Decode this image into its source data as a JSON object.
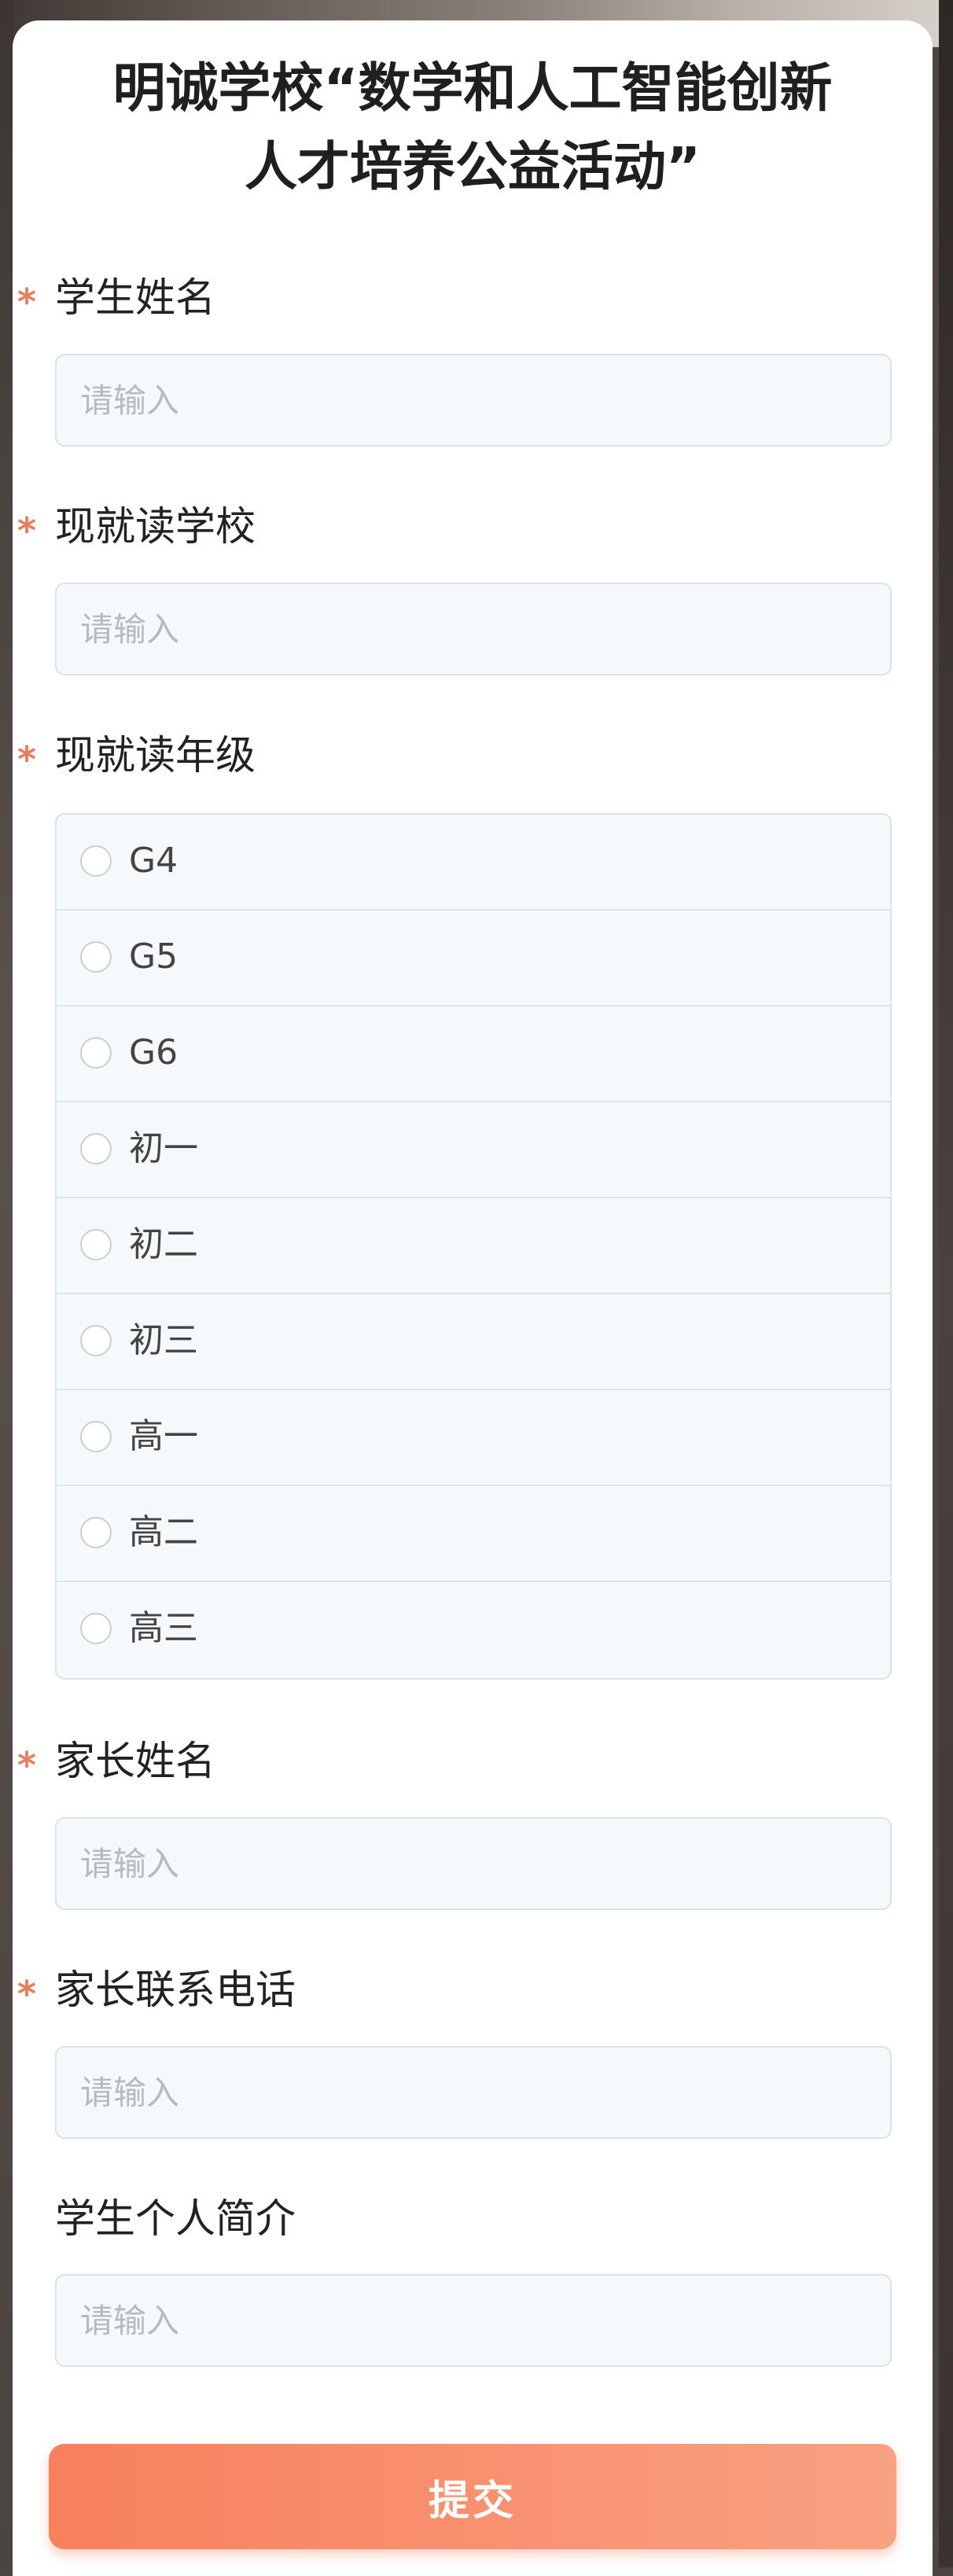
{
  "form": {
    "title_line1": "明诚学校“数学和人工智能创新",
    "title_line2": "人才培养公益活动”",
    "required_mark": "*",
    "fields": [
      {
        "label": "学生姓名",
        "placeholder": "请输入",
        "value": "",
        "required": true
      },
      {
        "label": "现就读学校",
        "placeholder": "请输入",
        "value": "",
        "required": true
      },
      {
        "label": "家长姓名",
        "placeholder": "请输入",
        "value": "",
        "required": true
      },
      {
        "label": "家长联系电话",
        "placeholder": "请输入",
        "value": "",
        "required": true
      },
      {
        "label": "学生个人简介",
        "placeholder": "请输入",
        "value": "",
        "required": false
      }
    ],
    "grade": {
      "label": "现就读年级",
      "required": true,
      "options": [
        "G4",
        "G5",
        "G6",
        "初一",
        "初二",
        "初三",
        "高一",
        "高二",
        "高三"
      ],
      "selected": null
    },
    "submit_label": "提交"
  },
  "colors": {
    "required_mark": "#e28060",
    "submit_button": "#f8805c",
    "input_background": "#f6f9fb",
    "input_border": "#dbe3e6",
    "placeholder": "#b4bcc1"
  }
}
